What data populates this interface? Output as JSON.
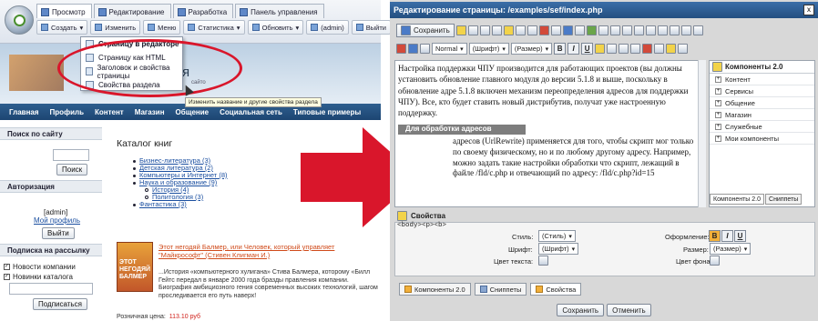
{
  "left": {
    "tabs": [
      "Просмотр",
      "Редактирование",
      "Разработка",
      "Панель управления"
    ],
    "buttons": [
      "Создать",
      "Изменить",
      "Меню",
      "Статистика",
      "Обновить",
      "(admin)",
      "Выйти"
    ],
    "dropdown": [
      "Страницу в редакторе",
      "Страницу как HTML",
      "Заголовок и свойства страницы",
      "Свойства раздела"
    ],
    "tooltip": "Изменить название и другие свойства раздела",
    "header_title": "ания",
    "header_sub": "сайто",
    "menu": [
      "Главная",
      "Профиль",
      "Контент",
      "Магазин",
      "Общение",
      "Социальная сеть",
      "Типовые примеры"
    ],
    "search": {
      "title": "Поиск по сайту",
      "button": "Поиск"
    },
    "auth": {
      "title": "Авторизация",
      "user": "[admin]",
      "profile": "Мой профиль",
      "logout": "Выйти"
    },
    "subscribe": {
      "title": "Подписка на рассылку",
      "opt1": "Новости компании",
      "opt2": "Новинки каталога",
      "button": "Подписаться"
    },
    "catalog": {
      "title": "Каталог книг",
      "items": [
        "Бизнес-литература (3)",
        "Детская литература (2)",
        "Компьютеры и Интернет (8)",
        "Наука и образование (9)",
        "История (4)",
        "Политология (3)",
        "Фантастика (3)"
      ]
    },
    "book": {
      "cover": "ЭТОТ НЕГОДЯЙ БАЛМЕР",
      "link": "Этот негодяй Балмер, или Человек, который управляет \"Майкрософт\" (Стивен Клигман И.)",
      "text": "...История «компьютерного хулигана» Стива Балмера, которому «Билл Гейтс передал в январе 2000 года бразды правления компании. Биография амбициозного гения современных высоких технологий, шагом проследивается его путь наверх!",
      "price_label": "Розничная цена:",
      "price": "113.10 руб"
    }
  },
  "right": {
    "title": "Редактирование страницы: /examples/sef/index.php",
    "close": "x",
    "save": "Сохранить",
    "style_sel": "Normal",
    "font_sel": "(Шрифт)",
    "size_sel": "(Размер)",
    "editor": {
      "p1": "Настройка поддержки ЧПУ производится для работающих проектов (вы должны установить обновление главного модуля до версии 5.1.8 и выше, поскольку в обновление адре 5.1.8 включен механизм переопределения адресов для поддержки ЧПУ). Все, кто будет ставить новый дистрибутив, получат уже настроенную поддержку.",
      "heading": "Для обработки адресов",
      "p2": "адресов (UrlRewrite) применяется для того, чтобы скрипт мог только по своему физическому, но и по любому другому адресу. Например, можно задать такие настройки обработки что скрипт, лежащий в файле /fld/c.php и отвечающий по адресу: /fld/c.php?id=15"
    },
    "components": {
      "title": "Компоненты 2.0",
      "items": [
        "Контент",
        "Сервисы",
        "Общение",
        "Магазин",
        "Служебные",
        "Мои компоненты"
      ],
      "tab1": "Компоненты 2.0",
      "tab2": "Сниппеты"
    },
    "props": {
      "title": "Свойства",
      "path": "<body><p><b>",
      "style_label": "Стиль:",
      "style_val": "(Стиль)",
      "font_label": "Шрифт:",
      "font_val": "(Шрифт)",
      "color_label": "Цвет текста:",
      "format_label": "Оформление:",
      "size_label": "Размер:",
      "size_val": "(Размер)",
      "bg_label": "Цвет фона:"
    },
    "bottom_tabs": [
      "Компоненты 2.0",
      "Сниппеты",
      "Свойства"
    ],
    "ok": "Сохранить",
    "cancel": "Отменить"
  },
  "colors": {
    "accent_red": "#d9162b",
    "menu_blue": "#1d4572",
    "titlebar": "#234f80",
    "price": "#d0201a"
  }
}
